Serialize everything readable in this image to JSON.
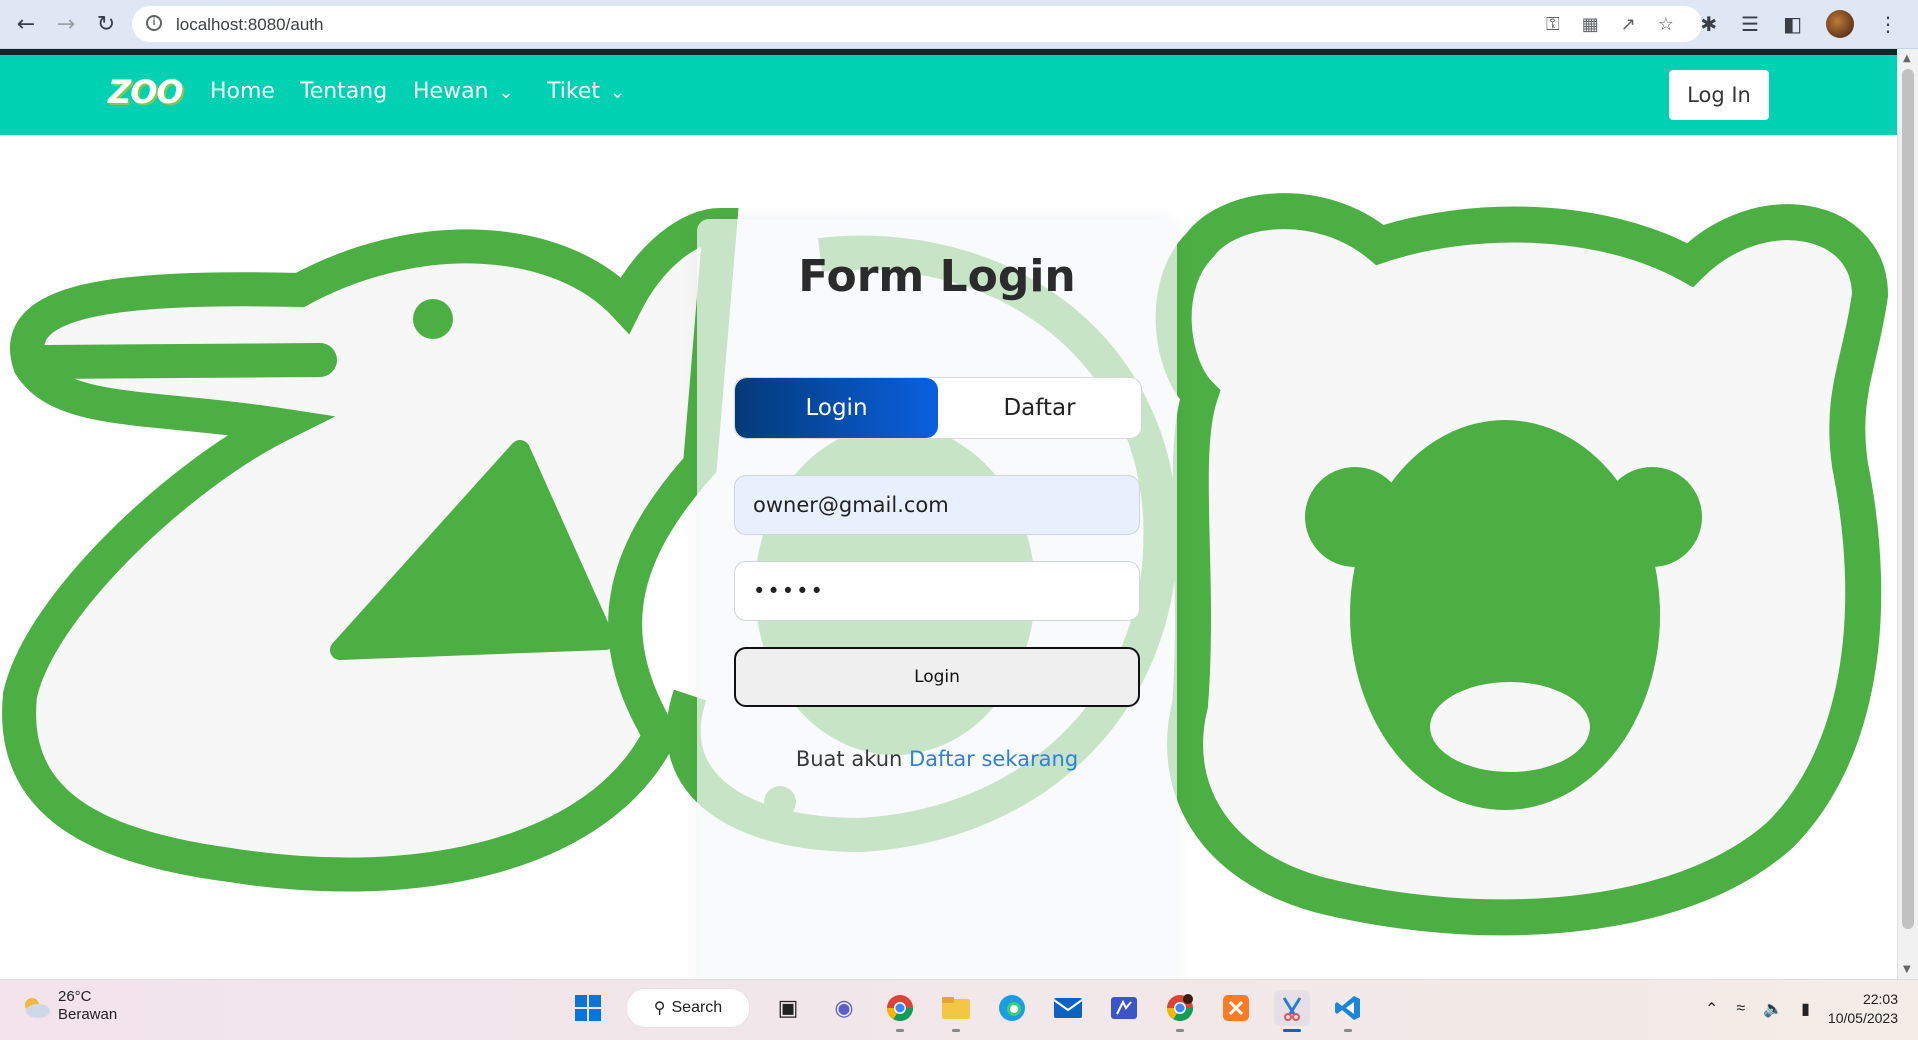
{
  "browser": {
    "url": "localhost:8080/auth"
  },
  "navbar": {
    "logo": "ZOO",
    "items": [
      {
        "label": "Home"
      },
      {
        "label": "Tentang"
      },
      {
        "label": "Hewan"
      },
      {
        "label": "Tiket"
      }
    ],
    "login_button": "Log In",
    "color": "#00d1b2"
  },
  "form": {
    "title": "Form Login",
    "tabs": [
      {
        "label": "Login",
        "active": true
      },
      {
        "label": "Daftar",
        "active": false
      }
    ],
    "email_value": "owner@gmail.com",
    "password_mask": "•••••",
    "submit_label": "Login",
    "signup_text": "Buat akun",
    "signup_link": "Daftar sekarang"
  },
  "taskbar": {
    "weather_temp": "26°C",
    "weather_condition": "Berawan",
    "search_label": "Search",
    "time": "22:03",
    "date": "10/05/2023"
  }
}
